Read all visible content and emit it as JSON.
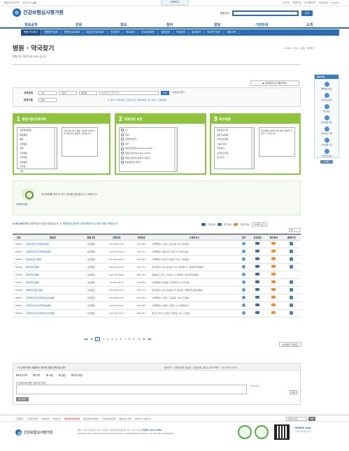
{
  "util": {
    "left_links": [
      "홈페이지로가기",
      "글자크기 ▲▼"
    ],
    "full_menu": "전체보기",
    "right_links": [
      "로그인",
      "회원가입",
      "마이페이지",
      "사이트맵",
      "English"
    ]
  },
  "header": {
    "logo_text": "건강보험심사평가원",
    "search_label": "통합검색",
    "search_button": "검색"
  },
  "main_nav": [
    "정보공개",
    "민원",
    "정보",
    "참여",
    "알림",
    "기관안내",
    "소개"
  ],
  "sub_nav": [
    "병원·약국찾기",
    "병원평가정보",
    "병원진료비정보",
    "비급여진료비정보",
    "건강정보",
    "의료정보",
    "진료비용확인",
    "질병정보",
    "약제정보",
    "통계정보",
    "의료연구정보",
    "새부교육"
  ],
  "page": {
    "title": "병원 · 약국찾기",
    "breadcrumb": "HOME > 정보 > 병원 · 약국찾기",
    "description": "병원·약국 정보검색 서비스입니다"
  },
  "quick_menu": {
    "header": "Quick",
    "items": [
      "병원평가정보",
      "비급여진료비",
      "의료정보",
      "진료비용 확인",
      "자주하는 질문",
      "진료비용 신고",
      "나의진료정보"
    ],
    "top": "TOP"
  },
  "guide_button": "▶ 검색방법 및 이용가이드",
  "search_form": {
    "row1_label": "지역검색",
    "sido": "시도",
    "sigungu": "시군구",
    "eupmyeondong": "읍면동",
    "keyword_placeholder": "병원명을 입력하세요",
    "search_button": "검색",
    "detail_button": "상세검색 열기",
    "row2_label": "운영구분",
    "row2_select": "전체",
    "note": "※ 검색 시 해당하는 조건을 모두 선택하세요 (예: 지역 + 진료과목)"
  },
  "panels": [
    {
      "num": "1",
      "title": "병원구분/진료과목",
      "list": [
        "상급종합병원",
        "종합병원",
        "병원",
        "요양병원",
        "의원",
        "치과병원",
        "치과의원",
        "한방병원",
        "한의원",
        "약국"
      ],
      "desc": "진료과목 또는 병원 구분을 선택하시면 해당하는 병원을 조회합니다."
    },
    {
      "num": "2",
      "title": "의료장비 보유",
      "list": [
        "CT",
        "MRI",
        "유방촬영장치",
        "PET",
        "혈관조영장치(Gamma Knife)",
        "혈관조영장치(Cyber Knife)",
        "혈관조영장치(양성자 치료기)",
        "체외충격파 쇄석기"
      ]
    },
    {
      "num": "3",
      "title": "특수병원",
      "list": [
        "응급의료기관",
        "분만가능병원",
        "희귀난치질환",
        "인공신장실",
        "투석환자",
        "소아야간진료",
        "호스피스"
      ],
      "desc": "특수병원 선택하시면 해당 병원을 조회할 수 있습니다."
    }
  ],
  "map": {
    "button_label": "검색위치설정",
    "message": "검색범위를 위하여 지도 위치를 설정해주시기 바랍니다."
  },
  "results": {
    "count": "84,552",
    "summary_prefix": "개의 요양기관이 검색 되었습니다.",
    "summary_suffix": "※ 병원명을 클릭하시면 병원정보 상세보기를 이용합니다.",
    "legend": [
      "진료정보",
      "평가정보",
      "진료비정보"
    ],
    "sort_label": "10개씩 보기"
  },
  "table": {
    "headers": [
      "번호",
      "병원명",
      "병원구분",
      "전화번호",
      "우편번호",
      "소재지주소",
      "위치",
      "진료정보",
      "평가정보",
      "홈페이지"
    ],
    "rows": [
      [
        "84552",
        "가톨릭대학교서울성모병원",
        "상급종합",
        "02-1588-1511",
        "137-040",
        "서울특별시 서초구 반포대로 222 (반포동)",
        true
      ],
      [
        "84551",
        "가톨릭대학교의정부성모병원",
        "상급종합",
        "02-3779-1114",
        "150-713",
        "서울특별시 영등포구 63로 10 (여의도동)",
        true
      ],
      [
        "84550",
        "강남세브란스병원",
        "상급종합",
        "02-1599-6114",
        "143-914",
        "서울특별시 광진구 능동로 120-1 (화양동)",
        true
      ],
      [
        "84549",
        "경북대학교병원",
        "상급종합",
        "053-420-5114",
        "700-721",
        "대구광역시 중구 동덕로 130 (삼덕동2가, 경북대학교병원)",
        true
      ],
      [
        "84548",
        "경상대학교병원",
        "상급종합",
        "055-750-8000",
        "660-702",
        "경상남도 진주시 강남로 79 (칠암동, 경상대학교병원)",
        false
      ],
      [
        "84547",
        "경희대학교병원",
        "상급종합",
        "02-958-8114",
        "130-872",
        "서울특별시 동대문구 경희대로 23 (회기동)",
        true
      ],
      [
        "84546",
        "계명대학교동산병원",
        "상급종합",
        "053-250-7114",
        "700-712",
        "대구광역시 중구 달성로 56 (동산동, 계명대학교동산병원)",
        true
      ],
      [
        "84545",
        "고려대학교의과대학부속구로병원",
        "상급종합",
        "02-2626-1114",
        "152-703",
        "서울특별시 구로구 구로동로 148 (구로동)",
        true
      ],
      [
        "84544",
        "고려대학교의과대학부속병원",
        "상급종합",
        "02-920-5114",
        "136-705",
        "서울특별시 성북구 인촌로 73 (안암동5가)",
        true
      ],
      [
        "84543",
        "고려대학교의과대학부속안산병원",
        "상급종합",
        "031-412-5114",
        "425-707",
        "경기도 안산시 단원구 적금로 123 (고잔동)",
        true
      ]
    ]
  },
  "pagination": {
    "first": "◀◀",
    "prev": "◀",
    "pages": [
      "1",
      "2",
      "3",
      "4",
      "5",
      "6",
      "7",
      "8",
      "9",
      "10"
    ],
    "next": "▶",
    "last": "▶▶"
  },
  "download_button": "검색결과 다운로드",
  "feedback": {
    "question": "» 이 콘텐츠에서 제공하는 정보에 대해 만족하십니까?",
    "contact": "담당부서 : 자원관리부   담당자 : 대표전화 1644-2000   팩스 : 02-6710-5751",
    "options": [
      "매우만족",
      "만족",
      "보통",
      "불만",
      "매우불만"
    ],
    "text_label": "이 콘텐츠에 대한 개선의견 입력",
    "count": "(0/500자)",
    "submit": "평가하기",
    "submit2": "등록"
  },
  "footer": {
    "links": [
      "고객헌장",
      "고객만족헌장",
      "이용약관",
      "이용안내",
      "개인정보처리방침",
      "영상정보처리방침",
      "저작권보호정책",
      "웹접근성 정책",
      "홈페이지 이용안내"
    ],
    "family_site": "관련사이트",
    "family_go": "이동",
    "logo_text": "건강보험심사평가원",
    "addr1": "서울시 서초구 반포로 267 (서초동) 건강보험심사평가원 (우) 137-706",
    "tel": "고객센터 1644-2000",
    "addr2": "COPYRIGHT© HEALTH INSURANCE REVIEW & ASSESSMENT SERVICE. ALL RIGHTS RESERVED",
    "mobile": "Mobile web",
    "mobile_sub": "모바일 웹 바로가기"
  }
}
